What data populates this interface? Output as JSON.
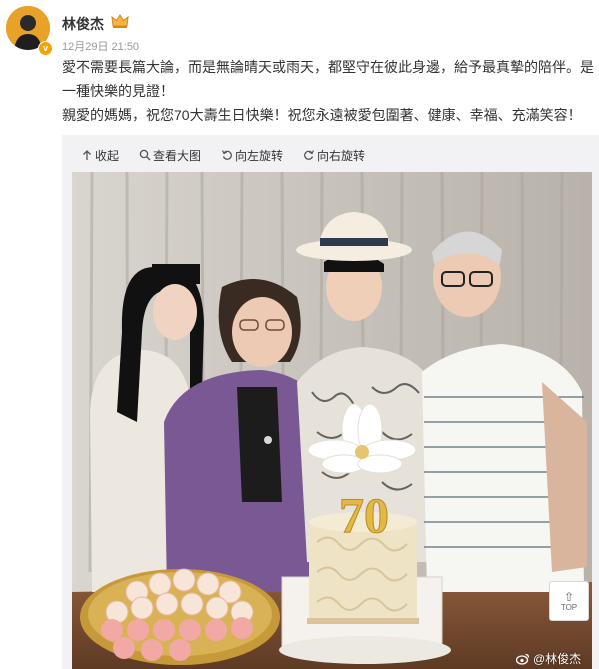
{
  "post": {
    "username": "林俊杰",
    "timestamp": "12月29日 21:50",
    "badge": "v",
    "text_line1": "愛不需要長篇大論，而是無論晴天或雨天，都堅守在彼此身邊，給予最真摯的陪伴。是一種快樂的見證！",
    "text_line2": "親愛的媽媽，祝您70大壽生日快樂！祝您永遠被愛包圍著、健康、幸福、充滿笑容！"
  },
  "toolbar": {
    "collapse": "收起",
    "view_large": "查看大图",
    "rotate_left": "向左旋转",
    "rotate_right": "向右旋转"
  },
  "photo": {
    "cake_number": "70",
    "watermark": "@林俊杰"
  },
  "back_to_top": {
    "label": "TOP"
  },
  "colors": {
    "accent": "#f4a300",
    "text": "#333333",
    "muted": "#999999",
    "toolbar_bg": "#f2f2f5"
  },
  "icons": [
    "avatar",
    "crown-icon",
    "collapse-icon",
    "zoom-icon",
    "rotate-left-icon",
    "rotate-right-icon",
    "weibo-icon"
  ]
}
